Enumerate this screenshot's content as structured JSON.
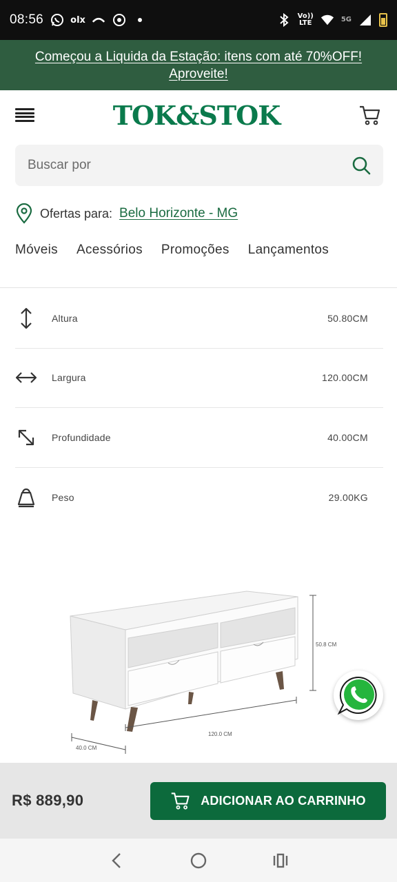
{
  "status_bar": {
    "time": "08:56",
    "notification_icons": [
      "whatsapp-icon",
      "olx-icon",
      "missed-call-icon",
      "chrome-icon",
      "dot-icon"
    ],
    "olx_label": "olx",
    "network_label_top": "Vo))",
    "network_label_bottom": "LTE",
    "network_5g": "5G",
    "status_icons": [
      "bluetooth-icon",
      "volte-icon",
      "wifi-icon",
      "signal-icon",
      "battery-icon"
    ]
  },
  "promo": {
    "text": "Começou a Liquida da Estação: itens com até 70%OFF! Aproveite!",
    "bg_color": "#2f5d40"
  },
  "header": {
    "logo": "TOK&STOK",
    "brand_color": "#0a7a4c"
  },
  "search": {
    "placeholder": "Buscar por"
  },
  "location": {
    "prefix": "Ofertas para:",
    "city": "Belo Horizonte - MG"
  },
  "nav": {
    "items": [
      "Móveis",
      "Acessórios",
      "Promoções",
      "Lançamentos"
    ]
  },
  "specs": [
    {
      "icon": "vertical-arrows-icon",
      "label": "Altura",
      "value": "50.80CM"
    },
    {
      "icon": "horizontal-arrows-icon",
      "label": "Largura",
      "value": "120.00CM"
    },
    {
      "icon": "diagonal-arrow-icon",
      "label": "Profundidade",
      "value": "40.00CM"
    },
    {
      "icon": "weight-icon",
      "label": "Peso",
      "value": "29.00KG"
    }
  ],
  "drawing": {
    "height_label": "50.8 CM",
    "width_label": "120.0 CM",
    "depth_label": "40.0 CM"
  },
  "buy": {
    "price": "R$ 889,90",
    "add_label": "ADICIONAR AO CARRINHO",
    "button_color": "#0c6a3c"
  }
}
